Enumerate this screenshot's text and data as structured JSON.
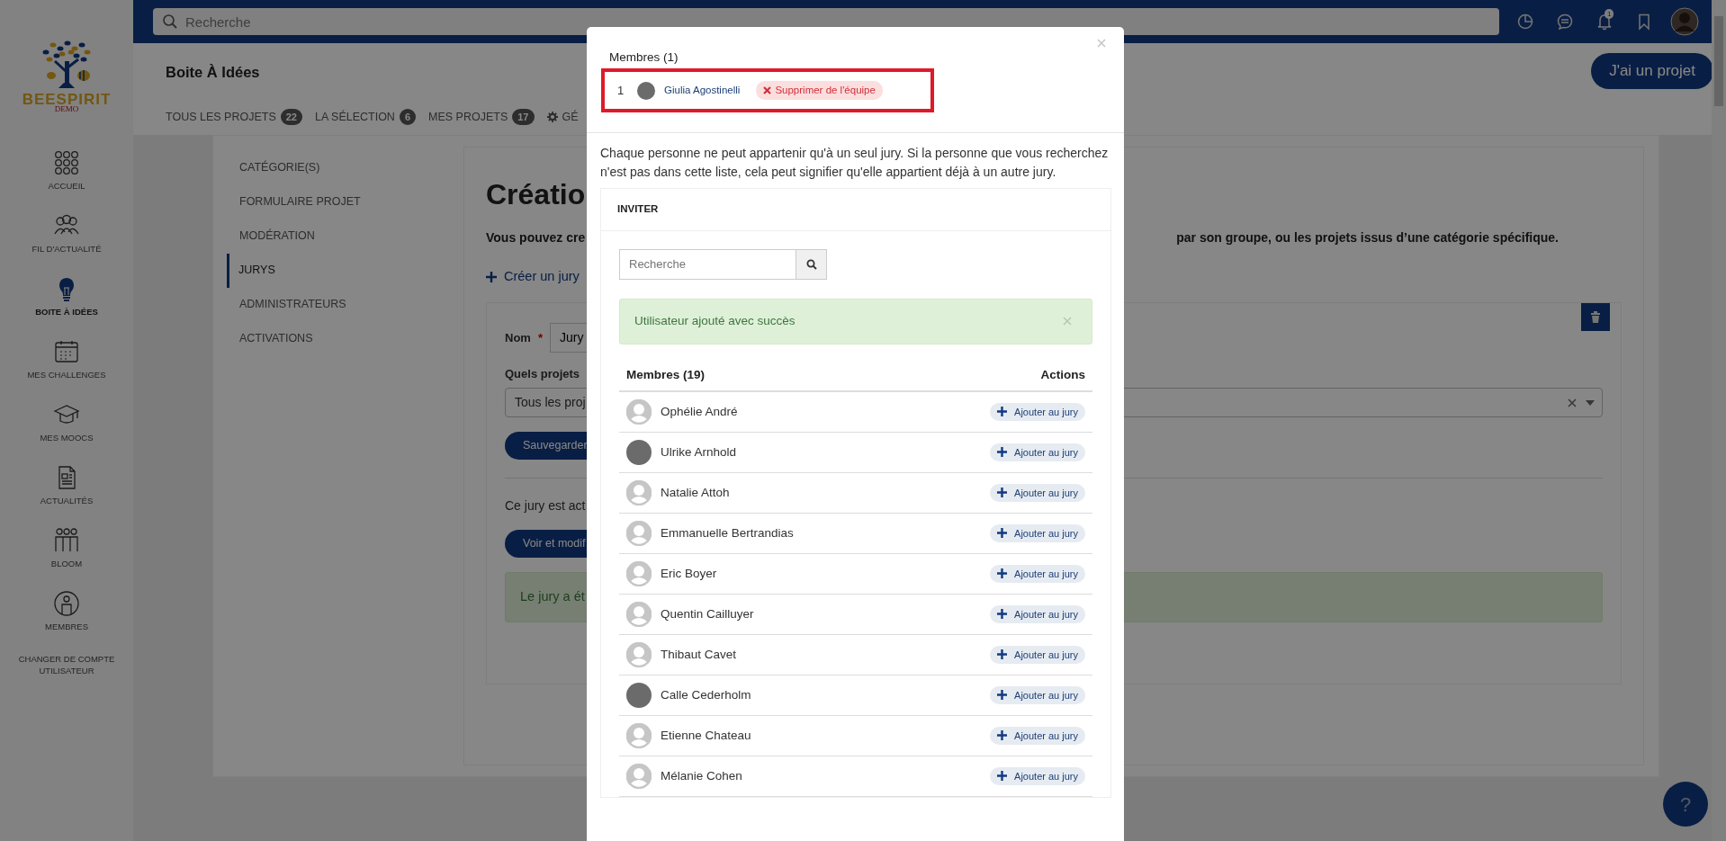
{
  "sidebar": {
    "logo_text": "BEESPIRIT",
    "logo_sub": "DEMO",
    "items": [
      {
        "label": "ACCUEIL",
        "selected": false
      },
      {
        "label": "FIL D'ACTUALITÉ",
        "selected": false
      },
      {
        "label": "BOITE À IDÉES",
        "selected": true
      },
      {
        "label": "MES CHALLENGES",
        "selected": false
      },
      {
        "label": "MES MOOCS",
        "selected": false
      },
      {
        "label": "ACTUALITÉS",
        "selected": false
      },
      {
        "label": "BLOOM",
        "selected": false
      },
      {
        "label": "MEMBRES",
        "selected": false
      },
      {
        "label": "CHANGER DE COMPTE UTILISATEUR",
        "selected": false
      }
    ]
  },
  "topbar": {
    "search_placeholder": "Recherche",
    "notification_count": "1"
  },
  "header": {
    "title": "Boite À Idées",
    "action_button": "J'ai un projet",
    "tabs": [
      {
        "kind": "count",
        "label": "TOUS LES PROJETS",
        "count": "22"
      },
      {
        "kind": "count",
        "label": "LA SÉLECTION",
        "count": "6"
      },
      {
        "kind": "count",
        "label": "MES PROJETS",
        "count": "17"
      },
      {
        "kind": "settings",
        "label": "GÉ"
      }
    ]
  },
  "settings_menu": {
    "items": [
      {
        "label": "CATÉGORIE(S)",
        "selected": false
      },
      {
        "label": "FORMULAIRE PROJET",
        "selected": false
      },
      {
        "label": "MODÉRATION",
        "selected": false
      },
      {
        "label": "JURYS",
        "selected": true
      },
      {
        "label": "ADMINISTRATEURS",
        "selected": false
      },
      {
        "label": "ACTIVATIONS",
        "selected": false
      }
    ]
  },
  "page": {
    "heading": "Créatio",
    "intro_left": "Vous pouvez cre",
    "intro_right": "par son groupe, ou les projets issus d’une catégorie spécifique.",
    "create_link": "Créer un jury",
    "jury_form": {
      "name_label": "Nom",
      "required_mark": "*",
      "name_value": "Jury",
      "projects_label": "Quels projets",
      "projects_value": "Tous les proj",
      "save_button": "Sauvegarder",
      "status_text": "Ce jury est act",
      "view_button": "Voir et modif",
      "alert": "Le jury a ét"
    }
  },
  "modal": {
    "team_title": "Membres (1)",
    "team_members": [
      {
        "index": "1",
        "name": "Giulia Agostinelli",
        "kind": "dark",
        "remove_button": "Supprimer de l'équipe",
        "highlighted": true
      }
    ],
    "notice": "Chaque personne ne peut appartenir qu'à un seul jury. Si la personne que vous recherchez n'est pas dans cette liste, cela peut signifier qu'elle appartient déjà à un autre jury.",
    "invite_title": "INVITER",
    "search_placeholder": "Recherche",
    "alert": "Utilisateur ajouté avec succès",
    "table": {
      "columns": [
        "Membres (19)",
        "Actions"
      ],
      "rows": [
        {
          "name": "Ophélie André",
          "kind": "placeholder",
          "action": "Ajouter au jury"
        },
        {
          "name": "Ulrike Arnhold",
          "kind": "dark",
          "action": "Ajouter au jury"
        },
        {
          "name": "Natalie Attoh",
          "kind": "placeholder",
          "action": "Ajouter au jury"
        },
        {
          "name": "Emmanuelle Bertrandias",
          "kind": "placeholder",
          "action": "Ajouter au jury"
        },
        {
          "name": "Eric Boyer",
          "kind": "placeholder",
          "action": "Ajouter au jury"
        },
        {
          "name": "Quentin Cailluyer",
          "kind": "placeholder",
          "action": "Ajouter au jury"
        },
        {
          "name": "Thibaut Cavet",
          "kind": "placeholder",
          "action": "Ajouter au jury"
        },
        {
          "name": "Calle Cederholm",
          "kind": "dark",
          "action": "Ajouter au jury"
        },
        {
          "name": "Etienne Chateau",
          "kind": "placeholder",
          "action": "Ajouter au jury"
        },
        {
          "name": "Mélanie Cohen",
          "kind": "placeholder",
          "action": "Ajouter au jury"
        }
      ]
    }
  },
  "help_button": "?"
}
